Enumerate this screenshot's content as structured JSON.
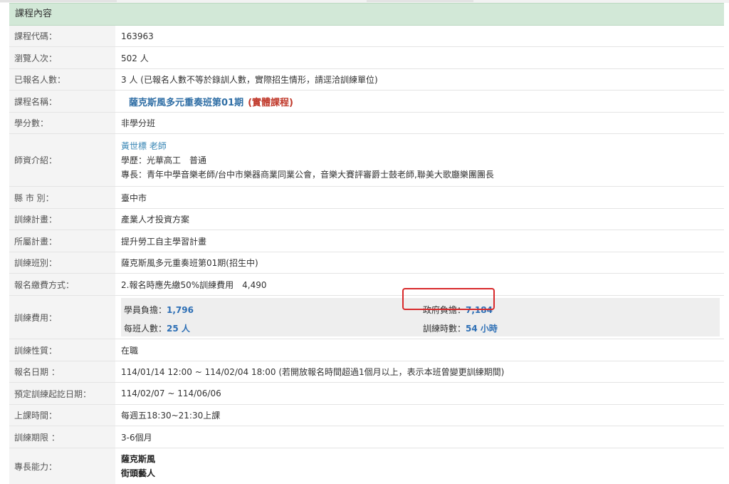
{
  "section_title": "課程內容",
  "rows": {
    "code": {
      "label": "課程代碼：",
      "value": "163963"
    },
    "views": {
      "label": "瀏覽人次：",
      "value": "502 人"
    },
    "enrolled": {
      "label": "已報名人數：",
      "value": "3 人 (已報名人數不等於錄訓人數，實際招生情形，請逕洽訓練單位)"
    },
    "name": {
      "label": "課程名稱：",
      "title": "薩克斯風多元重奏班第01期",
      "type": "(實體課程)"
    },
    "credit": {
      "label": "學分數：",
      "value": "非學分班"
    },
    "teacher": {
      "label": "師資介紹：",
      "name": "黃世標 老師",
      "education": "學歷：光華高工　普通",
      "expertise": "專長：青年中學音樂老師/台中市樂器商業同業公會，音樂大賽評審爵士鼓老師,聯美大歌廳樂團團長"
    },
    "city": {
      "label": "縣 市 別：",
      "value": "臺中市"
    },
    "plan": {
      "label": "訓練計畫：",
      "value": "產業人才投資方案"
    },
    "parent_plan": {
      "label": "所屬計畫：",
      "value": "提升勞工自主學習計畫"
    },
    "class": {
      "label": "訓練班別：",
      "value": "薩克斯風多元重奏班第01期(招生中)"
    },
    "payment": {
      "label": "報名繳費方式：",
      "value": "2.報名時應先繳50%訓練費用　4,490"
    },
    "fee": {
      "label": "訓練費用：",
      "student_label": "學員負擔：",
      "student_value": "1,796",
      "gov_label": "政府負擔：",
      "gov_value": "7,184",
      "size_label": "每班人數：",
      "size_value": "25 人",
      "hours_label": "訓練時數：",
      "hours_value": "54 小時"
    },
    "nature": {
      "label": "訓練性質：",
      "value": "在職"
    },
    "reg_date": {
      "label": "報名日期 ：",
      "value": "114/01/14 12:00 ~ 114/02/04 18:00 (若開放報名時間超過1個月以上，表示本班曾變更訓練期間)"
    },
    "period": {
      "label": "預定訓練起訖日期：",
      "value": "114/02/07 ~ 114/06/06"
    },
    "schedule": {
      "label": "上課時間：",
      "value": "每週五18:30~21:30上課"
    },
    "duration": {
      "label": "訓練期限 ：",
      "value": "3-6個月"
    },
    "skills": {
      "label": "專長能力：",
      "line1": "薩克斯風",
      "line2": "街頭藝人"
    }
  }
}
